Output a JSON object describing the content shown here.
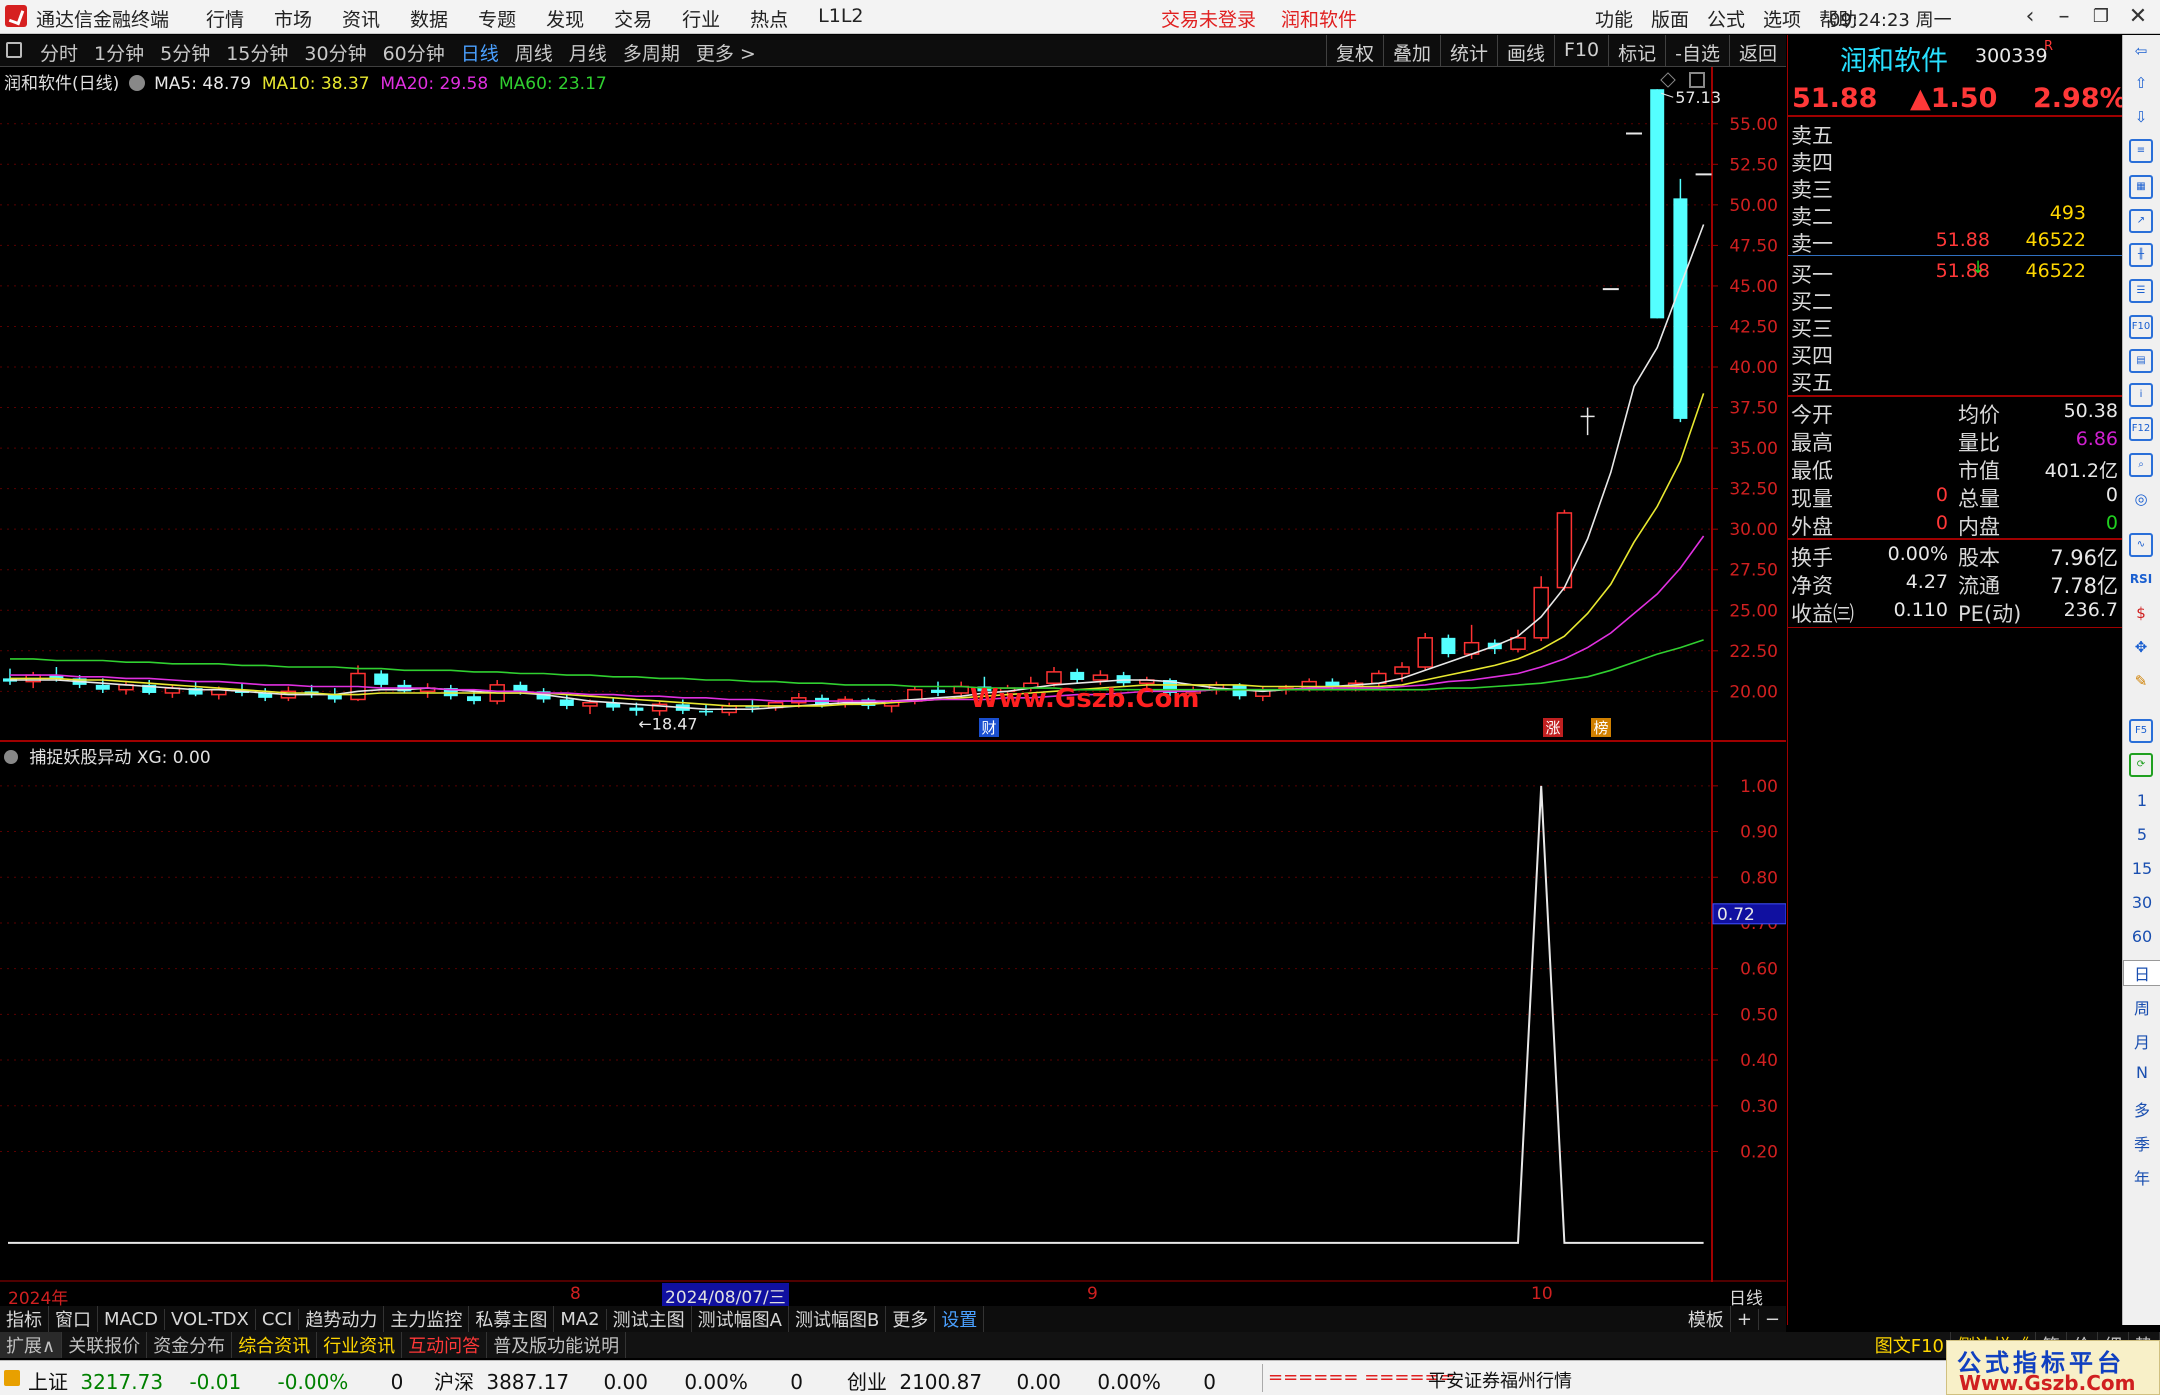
{
  "titlebar": {
    "app_title": "通达信金融终端",
    "menu": [
      "行情",
      "市场",
      "资讯",
      "数据",
      "专题",
      "发现",
      "交易",
      "行业",
      "热点",
      "L1L2"
    ],
    "alert_login": "交易未登录",
    "alert_stock": "润和软件",
    "right_menu": [
      "功能",
      "版面",
      "公式",
      "选项",
      "帮助"
    ],
    "clock": "09:24:23",
    "weekday": "周一"
  },
  "toolbar": {
    "periods": [
      "分时",
      "1分钟",
      "5分钟",
      "15分钟",
      "30分钟",
      "60分钟",
      "日线",
      "周线",
      "月线",
      "多周期",
      "更多 >"
    ],
    "active_period": "日线",
    "tools": [
      "复权",
      "叠加",
      "统计",
      "画线",
      "F10",
      "标记",
      "-自选",
      "返回"
    ]
  },
  "chart_data": [
    {
      "type": "candlestick",
      "title": "润和软件(日线)",
      "legend": [
        {
          "name": "MA5",
          "value": "48.79",
          "color": "#e8e8e8"
        },
        {
          "name": "MA10",
          "value": "38.37",
          "color": "#e8e830"
        },
        {
          "name": "MA20",
          "value": "29.58",
          "color": "#e030e0"
        },
        {
          "name": "MA60",
          "value": "23.17",
          "color": "#30d030"
        }
      ],
      "y_ticks": [
        "55.00",
        "52.50",
        "50.00",
        "47.50",
        "45.00",
        "42.50",
        "40.00",
        "37.50",
        "35.00",
        "32.50",
        "30.00",
        "27.50",
        "25.00",
        "22.50",
        "20.00"
      ],
      "ylim": [
        17.0,
        58.5
      ],
      "annotations": {
        "high": "57.13",
        "low": "18.47",
        "watermark": "Www.Gszb.Com",
        "marks": [
          "财",
          "涨",
          "榜"
        ]
      },
      "ohlc": [
        [
          20.8,
          21.4,
          20.4,
          20.6
        ],
        [
          20.6,
          21.2,
          20.2,
          21.0
        ],
        [
          21.0,
          21.5,
          20.6,
          20.8
        ],
        [
          20.8,
          21.0,
          20.2,
          20.4
        ],
        [
          20.4,
          20.8,
          19.9,
          20.1
        ],
        [
          20.1,
          20.6,
          19.8,
          20.4
        ],
        [
          20.4,
          20.7,
          19.8,
          19.9
        ],
        [
          19.9,
          20.4,
          19.6,
          20.2
        ],
        [
          20.2,
          20.6,
          19.7,
          19.8
        ],
        [
          19.8,
          20.3,
          19.5,
          20.1
        ],
        [
          20.1,
          20.5,
          19.7,
          19.9
        ],
        [
          19.9,
          20.2,
          19.4,
          19.6
        ],
        [
          19.6,
          20.3,
          19.4,
          20.0
        ],
        [
          20.0,
          20.4,
          19.6,
          19.8
        ],
        [
          19.8,
          20.2,
          19.3,
          19.5
        ],
        [
          19.5,
          21.6,
          19.4,
          21.1
        ],
        [
          21.1,
          21.3,
          20.2,
          20.4
        ],
        [
          20.4,
          20.7,
          19.9,
          20.0
        ],
        [
          20.0,
          20.5,
          19.6,
          20.2
        ],
        [
          20.2,
          20.4,
          19.5,
          19.7
        ],
        [
          19.7,
          20.0,
          19.2,
          19.4
        ],
        [
          19.4,
          20.7,
          19.2,
          20.4
        ],
        [
          20.4,
          20.6,
          19.8,
          20.0
        ],
        [
          20.0,
          20.2,
          19.3,
          19.5
        ],
        [
          19.5,
          19.8,
          18.9,
          19.1
        ],
        [
          19.1,
          19.5,
          18.6,
          19.3
        ],
        [
          19.3,
          19.6,
          18.8,
          19.0
        ],
        [
          19.0,
          19.3,
          18.5,
          18.8
        ],
        [
          18.8,
          19.4,
          18.5,
          19.2
        ],
        [
          19.2,
          19.5,
          18.6,
          18.8
        ],
        [
          18.8,
          19.2,
          18.5,
          18.7
        ],
        [
          18.7,
          19.3,
          18.5,
          19.1
        ],
        [
          19.1,
          19.5,
          18.7,
          19.0
        ],
        [
          19.0,
          19.4,
          18.8,
          19.3
        ],
        [
          19.3,
          19.9,
          19.0,
          19.6
        ],
        [
          19.6,
          19.8,
          19.0,
          19.2
        ],
        [
          19.2,
          19.7,
          19.0,
          19.5
        ],
        [
          19.5,
          19.6,
          18.9,
          19.1
        ],
        [
          19.1,
          19.5,
          18.7,
          19.4
        ],
        [
          19.4,
          20.3,
          19.2,
          20.1
        ],
        [
          20.1,
          20.6,
          19.7,
          19.9
        ],
        [
          19.9,
          20.6,
          19.6,
          20.3
        ],
        [
          20.3,
          20.9,
          19.9,
          20.0
        ],
        [
          20.0,
          20.4,
          19.6,
          20.2
        ],
        [
          20.2,
          20.9,
          20.0,
          20.5
        ],
        [
          20.5,
          21.5,
          20.3,
          21.2
        ],
        [
          21.2,
          21.4,
          20.5,
          20.7
        ],
        [
          20.7,
          21.3,
          20.4,
          21.0
        ],
        [
          21.0,
          21.2,
          20.3,
          20.5
        ],
        [
          20.5,
          20.9,
          20.1,
          20.7
        ],
        [
          20.7,
          20.8,
          19.7,
          19.9
        ],
        [
          19.9,
          20.3,
          19.6,
          20.1
        ],
        [
          20.1,
          20.6,
          19.8,
          20.4
        ],
        [
          20.4,
          20.5,
          19.5,
          19.7
        ],
        [
          19.7,
          20.3,
          19.4,
          20.1
        ],
        [
          20.1,
          20.4,
          19.8,
          20.2
        ],
        [
          20.2,
          20.8,
          20.0,
          20.6
        ],
        [
          20.6,
          20.8,
          20.1,
          20.3
        ],
        [
          20.3,
          20.7,
          20.0,
          20.5
        ],
        [
          20.5,
          21.3,
          20.3,
          21.1
        ],
        [
          21.1,
          21.8,
          20.6,
          21.5
        ],
        [
          21.5,
          23.6,
          21.3,
          23.3
        ],
        [
          23.3,
          23.5,
          22.1,
          22.3
        ],
        [
          22.3,
          24.1,
          22.0,
          23.0
        ],
        [
          23.0,
          23.2,
          22.3,
          22.6
        ],
        [
          22.6,
          23.8,
          22.4,
          23.3
        ],
        [
          23.3,
          27.1,
          23.1,
          26.4
        ],
        [
          26.4,
          31.2,
          26.2,
          31.0
        ],
        [
          37.0,
          37.5,
          35.8,
          37.0
        ],
        [
          44.8,
          44.8,
          44.8,
          44.8
        ],
        [
          54.4,
          54.4,
          54.4,
          54.4
        ],
        [
          57.13,
          57.13,
          43.0,
          43.0
        ],
        [
          50.4,
          51.6,
          36.6,
          36.8
        ],
        [
          51.88,
          51.88,
          51.88,
          51.88
        ]
      ],
      "ma": {
        "MA5": [
          20.7,
          20.7,
          20.7,
          20.6,
          20.5,
          20.4,
          20.3,
          20.2,
          20.1,
          20.1,
          20.0,
          19.9,
          19.8,
          19.8,
          19.8,
          20.0,
          20.1,
          20.1,
          20.2,
          20.1,
          20.0,
          19.9,
          19.9,
          19.8,
          19.6,
          19.4,
          19.3,
          19.2,
          19.1,
          19.0,
          18.9,
          18.9,
          18.9,
          19.0,
          19.1,
          19.2,
          19.3,
          19.3,
          19.4,
          19.5,
          19.6,
          19.7,
          19.9,
          20.0,
          20.2,
          20.4,
          20.5,
          20.6,
          20.7,
          20.7,
          20.6,
          20.4,
          20.2,
          20.1,
          20.0,
          20.1,
          20.2,
          20.3,
          20.4,
          20.5,
          20.8,
          21.3,
          21.8,
          22.3,
          22.8,
          23.4,
          24.6,
          26.4,
          29.4,
          33.5,
          38.8,
          41.2,
          45.0,
          48.79
        ],
        "MA10": [
          20.8,
          20.8,
          20.8,
          20.7,
          20.7,
          20.6,
          20.5,
          20.4,
          20.3,
          20.2,
          20.1,
          20.0,
          19.9,
          19.9,
          19.8,
          19.8,
          19.9,
          19.9,
          19.9,
          19.9,
          19.9,
          19.9,
          19.9,
          19.9,
          19.8,
          19.7,
          19.6,
          19.5,
          19.4,
          19.3,
          19.2,
          19.1,
          19.1,
          19.1,
          19.1,
          19.1,
          19.2,
          19.2,
          19.3,
          19.4,
          19.5,
          19.6,
          19.7,
          19.8,
          19.9,
          20.0,
          20.1,
          20.2,
          20.3,
          20.4,
          20.4,
          20.4,
          20.4,
          20.4,
          20.3,
          20.3,
          20.3,
          20.3,
          20.3,
          20.3,
          20.4,
          20.7,
          21.0,
          21.3,
          21.6,
          22.0,
          22.6,
          23.4,
          24.8,
          26.6,
          29.2,
          31.4,
          34.2,
          38.37
        ],
        "MA20": [
          21.0,
          21.0,
          21.0,
          20.9,
          20.9,
          20.8,
          20.8,
          20.7,
          20.6,
          20.6,
          20.5,
          20.4,
          20.4,
          20.3,
          20.3,
          20.3,
          20.2,
          20.2,
          20.2,
          20.1,
          20.1,
          20.0,
          20.0,
          19.9,
          19.9,
          19.8,
          19.8,
          19.7,
          19.7,
          19.6,
          19.6,
          19.5,
          19.5,
          19.4,
          19.4,
          19.4,
          19.4,
          19.4,
          19.4,
          19.4,
          19.5,
          19.5,
          19.5,
          19.6,
          19.6,
          19.7,
          19.8,
          19.8,
          19.9,
          20.0,
          20.0,
          20.0,
          20.1,
          20.1,
          20.1,
          20.1,
          20.2,
          20.2,
          20.2,
          20.2,
          20.3,
          20.4,
          20.6,
          20.7,
          20.9,
          21.1,
          21.5,
          22.0,
          22.7,
          23.6,
          24.8,
          26.0,
          27.6,
          29.58
        ],
        "MA60": [
          22.0,
          22.0,
          21.9,
          21.9,
          21.9,
          21.8,
          21.8,
          21.7,
          21.7,
          21.7,
          21.6,
          21.6,
          21.5,
          21.5,
          21.5,
          21.4,
          21.4,
          21.3,
          21.3,
          21.3,
          21.2,
          21.2,
          21.1,
          21.1,
          21.0,
          21.0,
          20.9,
          20.9,
          20.8,
          20.8,
          20.7,
          20.7,
          20.6,
          20.6,
          20.5,
          20.5,
          20.4,
          20.4,
          20.4,
          20.3,
          20.3,
          20.3,
          20.2,
          20.2,
          20.2,
          20.2,
          20.1,
          20.1,
          20.1,
          20.1,
          20.1,
          20.1,
          20.1,
          20.1,
          20.1,
          20.1,
          20.1,
          20.1,
          20.1,
          20.1,
          20.1,
          20.1,
          20.2,
          20.2,
          20.3,
          20.4,
          20.5,
          20.7,
          20.9,
          21.3,
          21.8,
          22.3,
          22.7,
          23.17
        ]
      }
    },
    {
      "type": "line",
      "title": "捕捉妖股异动",
      "series": [
        {
          "name": "XG",
          "value_label": "0.00",
          "values": [
            0,
            0,
            0,
            0,
            0,
            0,
            0,
            0,
            0,
            0,
            0,
            0,
            0,
            0,
            0,
            0,
            0,
            0,
            0,
            0,
            0,
            0,
            0,
            0,
            0,
            0,
            0,
            0,
            0,
            0,
            0,
            0,
            0,
            0,
            0,
            0,
            0,
            0,
            0,
            0,
            0,
            0,
            0,
            0,
            0,
            0,
            0,
            0,
            0,
            0,
            0,
            0,
            0,
            0,
            0,
            0,
            0,
            0,
            0,
            0,
            0,
            0,
            0,
            0,
            0,
            0,
            1,
            0,
            0,
            0,
            0,
            0,
            0,
            0
          ]
        }
      ],
      "y_ticks": [
        "1.00",
        "0.90",
        "0.80",
        "0.70",
        "0.60",
        "0.50",
        "0.40",
        "0.30",
        "0.20"
      ],
      "ylim": [
        -0.02,
        1.05
      ],
      "cursor_value": "0.72"
    }
  ],
  "datebar": {
    "year": "2024年",
    "month8": "8",
    "cursor_date": "2024/08/07/三",
    "month9": "9",
    "month10": "10",
    "period": "日线"
  },
  "tabs1": [
    "指标",
    "窗口",
    "MACD",
    "VOL-TDX",
    "CCI",
    "趋势动力",
    "主力监控",
    "私募主图",
    "MA2",
    "测试主图",
    "测试幅图A",
    "测试幅图B",
    "更多",
    "设置"
  ],
  "tabs1_right": [
    "模板",
    "+",
    "−"
  ],
  "tabs2": [
    "扩展∧",
    "关联报价",
    "资金分布",
    "综合资讯",
    "行业资讯",
    "互动问答",
    "普及版功能说明"
  ],
  "tabs2_right": [
    "图文F10",
    "侧边栏《",
    "笔",
    "价",
    "细",
    "势"
  ],
  "quote": {
    "name": "润和软件",
    "code": "300339",
    "flag": "R",
    "price": "51.88",
    "change": "▲1.50",
    "pct": "2.98%",
    "asks": [
      {
        "label": "卖五",
        "price": "",
        "vol": ""
      },
      {
        "label": "卖四",
        "price": "",
        "vol": ""
      },
      {
        "label": "卖三",
        "price": "",
        "vol": ""
      },
      {
        "label": "卖二",
        "price": "",
        "vol": "493"
      },
      {
        "label": "卖一",
        "price": "51.88",
        "vol": "46522"
      }
    ],
    "bids": [
      {
        "label": "买一",
        "price": "51.88",
        "arrow": "↓",
        "vol": "46522"
      },
      {
        "label": "买二",
        "price": "",
        "vol": ""
      },
      {
        "label": "买三",
        "price": "",
        "vol": ""
      },
      {
        "label": "买四",
        "price": "",
        "vol": ""
      },
      {
        "label": "买五",
        "price": "",
        "vol": ""
      }
    ],
    "stats": [
      {
        "l1": "今开",
        "v1": "",
        "l2": "均价",
        "v2": "50.38"
      },
      {
        "l1": "最高",
        "v1": "",
        "l2": "量比",
        "v2": "6.86"
      },
      {
        "l1": "最低",
        "v1": "",
        "l2": "市值",
        "v2": "401.2亿"
      },
      {
        "l1": "现量",
        "v1": "0",
        "l2": "总量",
        "v2": "0"
      },
      {
        "l1": "外盘",
        "v1": "0",
        "l2": "内盘",
        "v2": "0"
      }
    ],
    "fundamentals": [
      {
        "l1": "换手",
        "v1": "0.00%",
        "l2": "股本",
        "v2": "7.96亿"
      },
      {
        "l1": "净资",
        "v1": "4.27",
        "l2": "流通",
        "v2": "7.78亿"
      },
      {
        "l1": "收益㈢",
        "v1": "0.110",
        "l2": "PE(动)",
        "v2": "236.7"
      }
    ]
  },
  "sidebar_periods": [
    "1",
    "5",
    "15",
    "30",
    "60",
    "日",
    "周",
    "月",
    "N",
    "多",
    "季",
    "年"
  ],
  "statusbar": {
    "indices": [
      {
        "name": "上证",
        "value": "3217.73",
        "change": "-0.01",
        "pct": "-0.00%",
        "vol": "0"
      },
      {
        "name": "沪深",
        "value": "3887.17",
        "change": "0.00",
        "pct": "0.00%",
        "vol": "0"
      },
      {
        "name": "创业",
        "value": "2100.87",
        "change": "0.00",
        "pct": "0.00%",
        "vol": "0"
      }
    ],
    "ticker": "====== ======",
    "broker": "平安证券福州行情"
  },
  "watermark_brand": {
    "line1": "公式指标平台",
    "line2": "Www.Gszb.Com"
  }
}
